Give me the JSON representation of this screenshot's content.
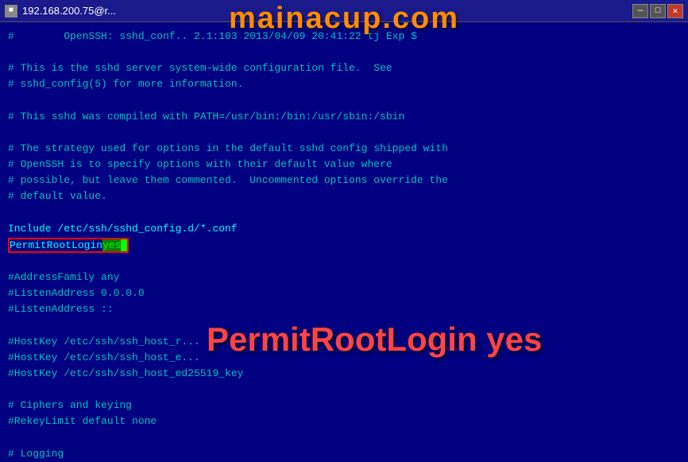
{
  "titlebar": {
    "title": "192.168.200.75@r...",
    "icon": "■",
    "buttons": [
      "—",
      "□",
      "✕"
    ]
  },
  "watermark": "mainacup.com",
  "overlay": "PermitRootLogin yes",
  "terminal": {
    "lines": [
      {
        "id": "line1",
        "text": "#\t\t/OpenSSH: sshd_conf..  2.1:103 2013/04/09 20:41:22 tj Exp $",
        "type": "comment"
      },
      {
        "id": "line2",
        "text": "",
        "type": "empty"
      },
      {
        "id": "line3",
        "text": "# This is the sshd server system-wide configuration file.  See",
        "type": "comment"
      },
      {
        "id": "line4",
        "text": "# sshd_config(5) for more information.",
        "type": "comment"
      },
      {
        "id": "line5",
        "text": "",
        "type": "empty"
      },
      {
        "id": "line6",
        "text": "# This sshd was compiled with PATH=/usr/bin:/bin:/usr/sbin:/sbin",
        "type": "comment"
      },
      {
        "id": "line7",
        "text": "",
        "type": "empty"
      },
      {
        "id": "line8",
        "text": "# The strategy used for options in the default sshd config shipped with",
        "type": "comment"
      },
      {
        "id": "line9",
        "text": "# OpenSSH is to specify options with their default value where",
        "type": "comment"
      },
      {
        "id": "line10",
        "text": "# possible, but leave them commented.  Uncommented options override the",
        "type": "comment"
      },
      {
        "id": "line11",
        "text": "# default value.",
        "type": "comment"
      },
      {
        "id": "line12",
        "text": "",
        "type": "empty"
      },
      {
        "id": "line13",
        "text": "Include /etc/ssh/sshd_config.d/*.conf",
        "type": "normal"
      },
      {
        "id": "line14",
        "text": "PERMIT_ROOT_LOGIN_YES",
        "type": "permit"
      },
      {
        "id": "line15",
        "text": "",
        "type": "empty"
      },
      {
        "id": "line16",
        "text": "#AddressFamily any",
        "type": "comment"
      },
      {
        "id": "line17",
        "text": "#ListenAddress 0.0.0.0",
        "type": "comment"
      },
      {
        "id": "line18",
        "text": "#ListenAddress ::",
        "type": "comment"
      },
      {
        "id": "line19",
        "text": "",
        "type": "empty"
      },
      {
        "id": "line20",
        "text": "#HostKey /etc/ssh/ssh_host_r...",
        "type": "comment"
      },
      {
        "id": "line21",
        "text": "#HostKey /etc/ssh/ssh_host_e...",
        "type": "comment"
      },
      {
        "id": "line22",
        "text": "#HostKey /etc/ssh/ssh_host_ed25519_key",
        "type": "comment"
      },
      {
        "id": "line23",
        "text": "",
        "type": "empty"
      },
      {
        "id": "line24",
        "text": "# Ciphers and keying",
        "type": "comment"
      },
      {
        "id": "line25",
        "text": "#RekeyLimit default none",
        "type": "comment"
      },
      {
        "id": "line26",
        "text": "",
        "type": "empty"
      },
      {
        "id": "line27",
        "text": "# Logging",
        "type": "comment"
      }
    ]
  }
}
